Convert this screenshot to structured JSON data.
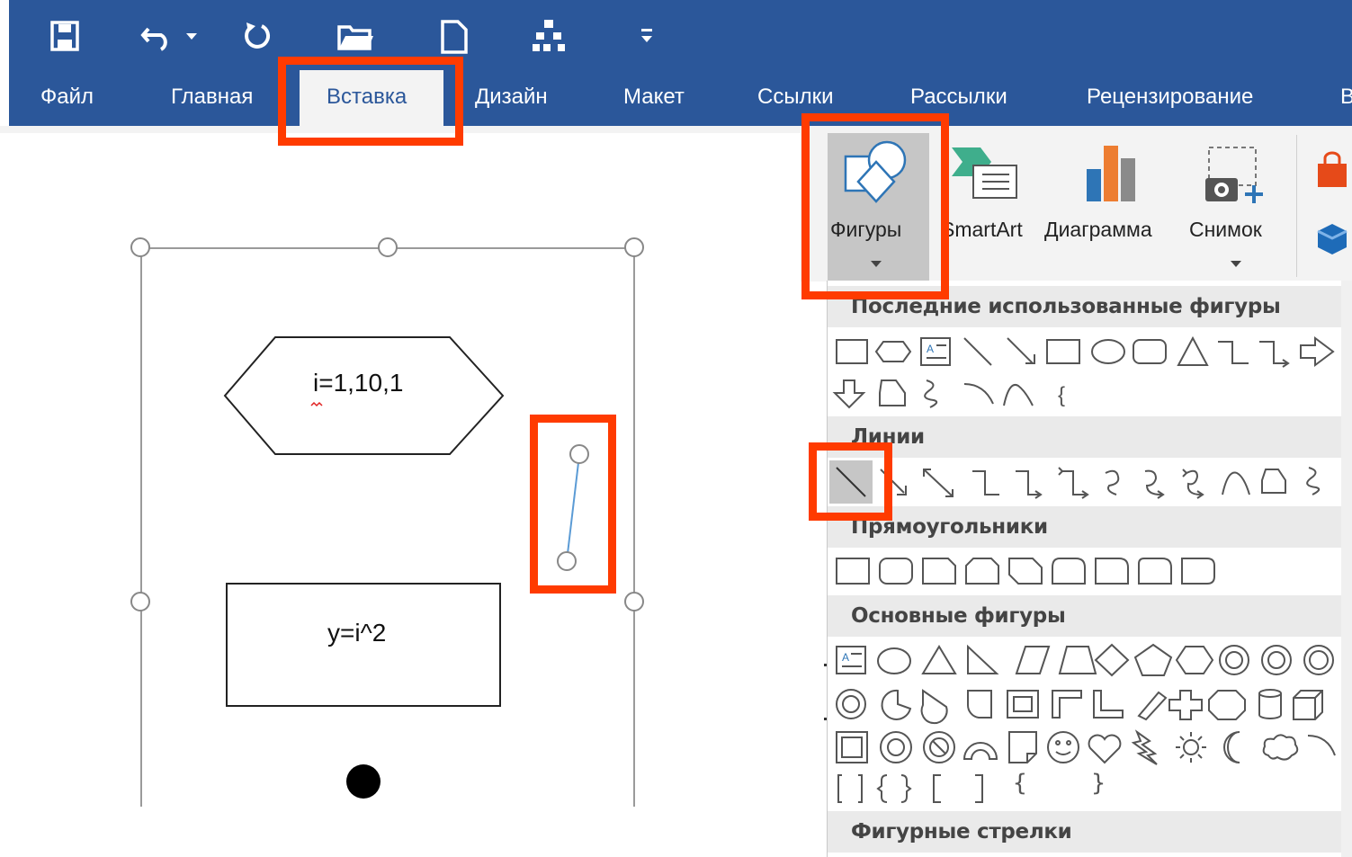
{
  "qat": {
    "icons": [
      "save-icon",
      "undo-icon",
      "undo-dropdown-icon",
      "redo-icon",
      "open-folder-icon",
      "new-document-icon",
      "org-chart-icon",
      "customize-qat-icon"
    ]
  },
  "tabs": [
    {
      "label": "Файл"
    },
    {
      "label": "Главная"
    },
    {
      "label": "Вставка"
    },
    {
      "label": "Дизайн"
    },
    {
      "label": "Макет"
    },
    {
      "label": "Ссылки"
    },
    {
      "label": "Рассылки"
    },
    {
      "label": "Рецензирование"
    },
    {
      "label": "В"
    }
  ],
  "active_tab": "Вставка",
  "ribbon": {
    "shapes_label": "Фигуры",
    "smartart_label": "SmartArt",
    "chart_label": "Диаграмма",
    "screenshot_label": "Снимок"
  },
  "gallery": {
    "sections": [
      {
        "title": "Последние использованные фигуры"
      },
      {
        "title": "Линии"
      },
      {
        "title": "Прямоугольники"
      },
      {
        "title": "Основные фигуры"
      },
      {
        "title": "Фигурные стрелки"
      }
    ],
    "braces_row": "{ }"
  },
  "document": {
    "hexagon_text": "i=1,10,1",
    "rect_text": "y=i^2"
  },
  "colors": {
    "ribbon_blue": "#2b579a",
    "highlight": "#ff3b00",
    "line_selected": "#5b9bd5"
  }
}
